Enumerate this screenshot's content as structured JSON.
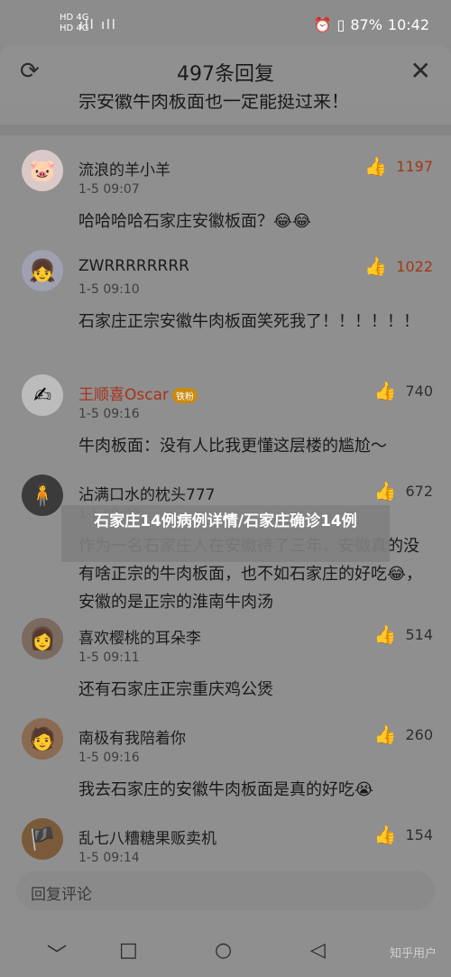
{
  "status_bar": {
    "network_top": "HD 4G",
    "network_bottom": "HD 4G",
    "signal": "ıll ıll",
    "wifi": "≋",
    "alarm": "⏰",
    "vibrate": "▯",
    "battery": "87%",
    "time": "10:42"
  },
  "header": {
    "title": "497条回复",
    "refresh_icon": "refresh-icon",
    "close_icon": "close-icon"
  },
  "partial_text": "宗安徽牛肉板面也一定能挺过来！",
  "comments": [
    {
      "name": "流浪的羊小羊",
      "time": "1-5 09:07",
      "text": "哈哈哈哈石家庄安徽板面？😂😂",
      "likes": "1197",
      "liked": true,
      "avatar": "🐷",
      "avatar_bg": "#d9c9c9"
    },
    {
      "name": "ZWRRRRRRRR",
      "time": "1-5 09:10",
      "text": "石家庄正宗安徽牛肉板面笑死我了！！！！！！",
      "likes": "1022",
      "liked": true,
      "avatar": "👧",
      "avatar_bg": "#9fa0b0"
    },
    {
      "name": "王顺喜Oscar",
      "badge": "铁粉",
      "time": "1-5 09:16",
      "text": "牛肉板面：没有人比我更懂这层楼的尴尬～",
      "likes": "740",
      "liked": false,
      "avatar": "✍",
      "avatar_bg": "#bcbcbc"
    },
    {
      "name": "沾满口水的枕头777",
      "time": "1-5 09:09",
      "text": "作为一名石家庄人在安徽待了三年，安徽真的没有啥正宗的牛肉板面，也不如石家庄的好吃😂，安徽的是正宗的淮南牛肉汤",
      "likes": "672",
      "liked": false,
      "avatar": "🧍",
      "avatar_bg": "#3b3b3b"
    },
    {
      "name": "喜欢樱桃的耳朵李",
      "time": "1-5 09:11",
      "text": "还有石家庄正宗重庆鸡公煲",
      "likes": "514",
      "liked": false,
      "avatar": "👩",
      "avatar_bg": "#7a6a60"
    },
    {
      "name": "南极有我陪着你",
      "time": "1-5 09:16",
      "text": "我去石家庄的安徽牛肉板面是真的好吃😭",
      "likes": "260",
      "liked": false,
      "avatar": "🧑",
      "avatar_bg": "#8a6a50"
    },
    {
      "name": "乱七八糟糖果贩卖机",
      "time": "1-5 09:14",
      "text": "",
      "likes": "154",
      "liked": false,
      "avatar": "🏴",
      "avatar_bg": "#7a5a3a"
    }
  ],
  "overlay_title": "石家庄14例病例详情/石家庄确诊14例",
  "input_placeholder": "回复评论",
  "nav": {
    "back": "﹀",
    "home": "□",
    "circle": "○",
    "triangle": "◁"
  },
  "watermark": "知乎用户"
}
